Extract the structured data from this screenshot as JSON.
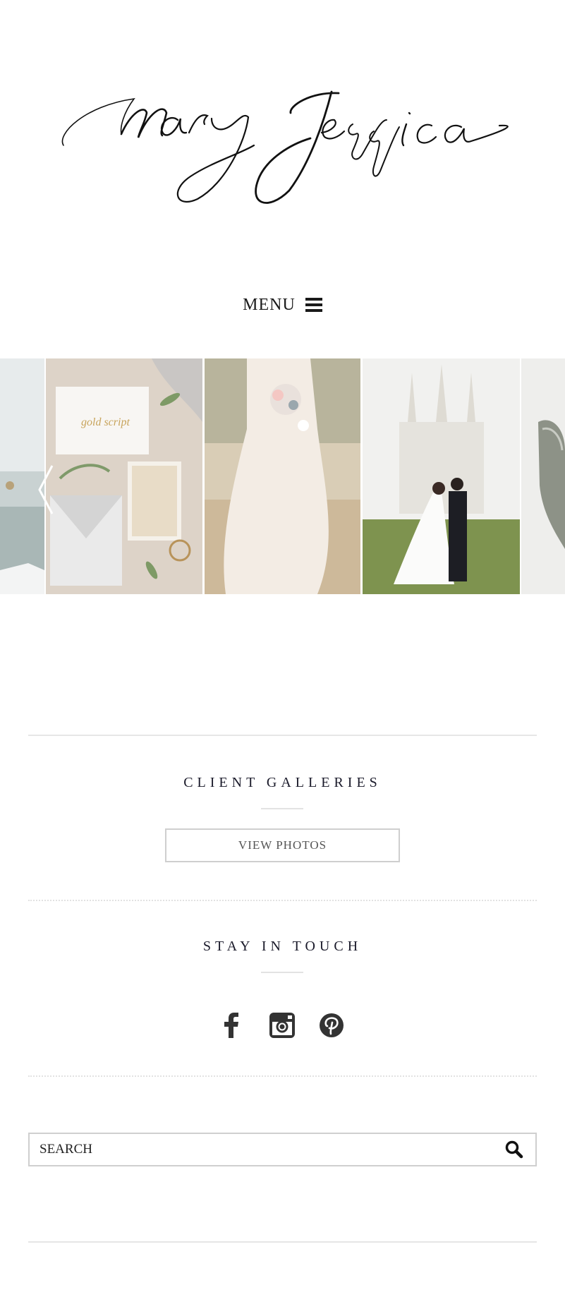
{
  "site": {
    "brand": "Mary Jessica"
  },
  "nav": {
    "menu_label": "MENU",
    "menu_icon": "hamburger-icon"
  },
  "gallery": {
    "slides": [
      {
        "subject": "coastline"
      },
      {
        "subject": "invitation suite"
      },
      {
        "subject": "bride with bouquet"
      },
      {
        "subject": "couple at temple"
      },
      {
        "subject": "shoes"
      }
    ],
    "prev_icon": "chevron-left-icon"
  },
  "client_galleries": {
    "title": "CLIENT GALLERIES",
    "button_label": "VIEW PHOTOS"
  },
  "stay_in_touch": {
    "title": "STAY IN TOUCH",
    "icons": [
      "facebook-icon",
      "instagram-icon",
      "pinterest-icon"
    ]
  },
  "search": {
    "placeholder": "SEARCH",
    "icon": "search-icon"
  },
  "colors": {
    "text": "#1a1a1a",
    "rule": "#e6e6e6",
    "border": "#cfcfcf"
  }
}
